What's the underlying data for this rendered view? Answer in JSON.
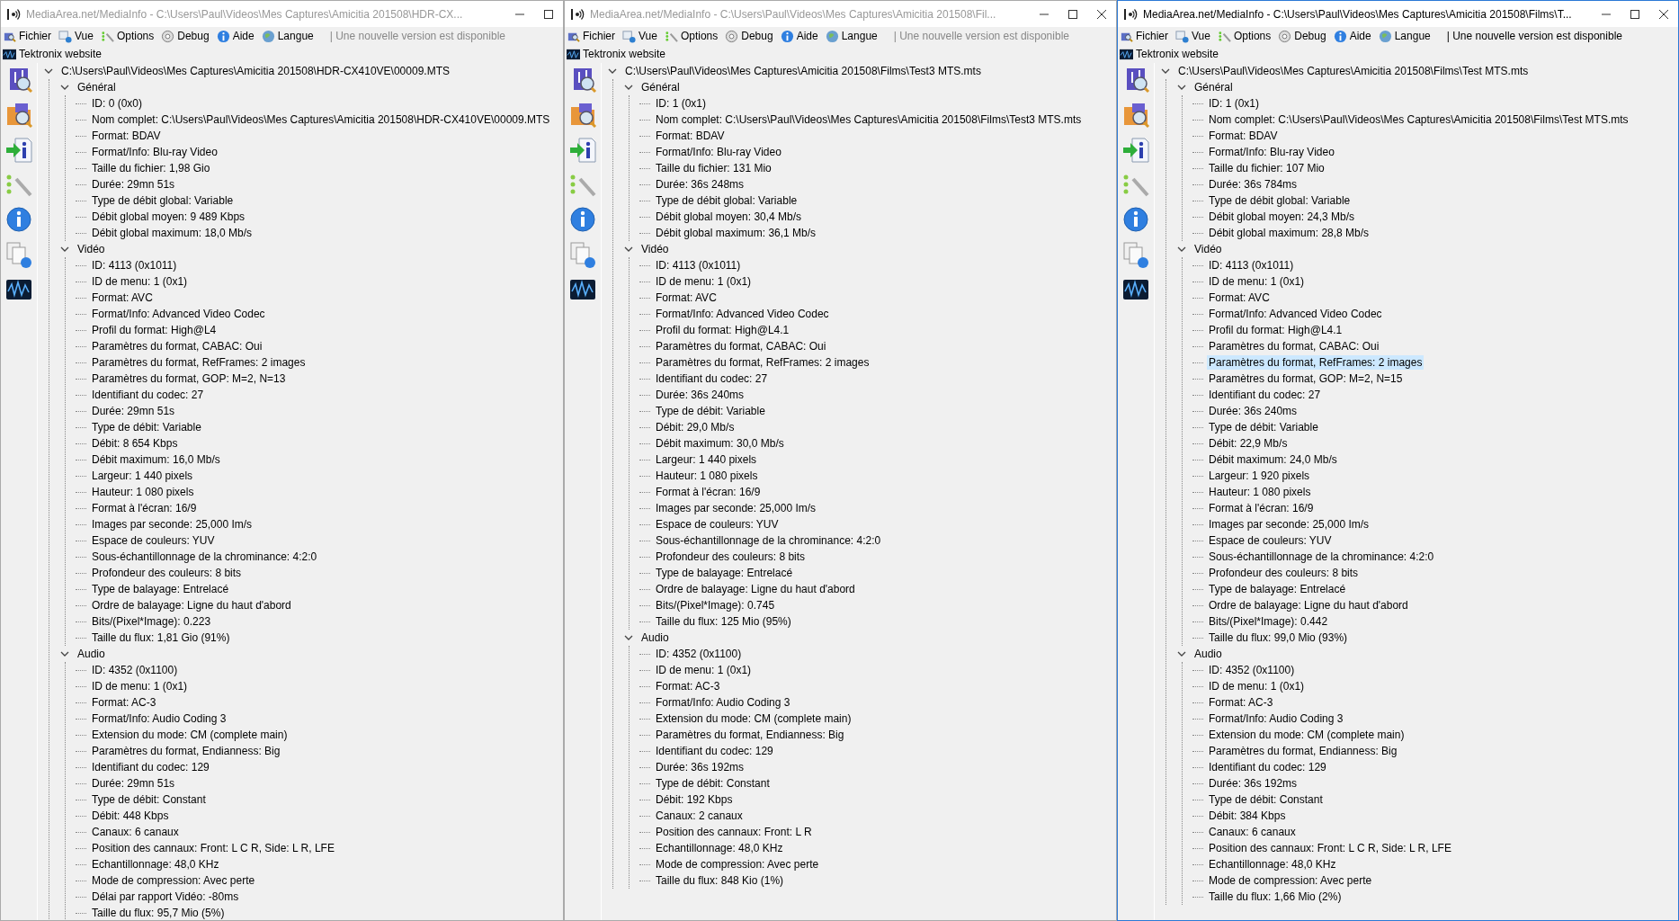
{
  "windows": [
    {
      "title": "MediaArea.net/MediaInfo - C:\\Users\\Paul\\Videos\\Mes Captures\\Amicitia 201508\\HDR-CX...",
      "active": false,
      "controls": [
        {
          "kind": "minimize"
        },
        {
          "kind": "maximize"
        }
      ],
      "menu": [
        "Fichier",
        "Vue",
        "Options",
        "Debug",
        "Aide",
        "Langue"
      ],
      "notice": "| Une nouvelle version est disponible",
      "website": "Tektronix website",
      "tree": {
        "text": "C:\\Users\\Paul\\Videos\\Mes Captures\\Amicitia 201508\\HDR-CX410VE\\00009.MTS",
        "expanded": true,
        "selected": false,
        "children": [
          {
            "text": "Général",
            "expanded": true,
            "selected": false,
            "children": [
              {
                "text": "ID: 0 (0x0)",
                "selected": false
              },
              {
                "text": "Nom complet: C:\\Users\\Paul\\Videos\\Mes Captures\\Amicitia 201508\\HDR-CX410VE\\00009.MTS",
                "selected": false
              },
              {
                "text": "Format: BDAV",
                "selected": false
              },
              {
                "text": "Format/Info: Blu-ray Video",
                "selected": false
              },
              {
                "text": "Taille du fichier: 1,98 Gio",
                "selected": false
              },
              {
                "text": "Durée: 29mn 51s",
                "selected": false
              },
              {
                "text": "Type de débit global: Variable",
                "selected": false
              },
              {
                "text": "Débit global moyen: 9 489 Kbps",
                "selected": false
              },
              {
                "text": "Débit global maximum: 18,0 Mb/s",
                "selected": false
              }
            ]
          },
          {
            "text": "Vidéo",
            "expanded": true,
            "selected": false,
            "children": [
              {
                "text": "ID: 4113 (0x1011)",
                "selected": false
              },
              {
                "text": "ID de menu: 1 (0x1)",
                "selected": false
              },
              {
                "text": "Format: AVC",
                "selected": false
              },
              {
                "text": "Format/Info: Advanced Video Codec",
                "selected": false
              },
              {
                "text": "Profil du format: High@L4",
                "selected": false
              },
              {
                "text": "Paramètres du format, CABAC: Oui",
                "selected": false
              },
              {
                "text": "Paramètres du format, RefFrames: 2 images",
                "selected": false
              },
              {
                "text": "Paramètres du format, GOP: M=2, N=13",
                "selected": false
              },
              {
                "text": "Identifiant du codec: 27",
                "selected": false
              },
              {
                "text": "Durée: 29mn 51s",
                "selected": false
              },
              {
                "text": "Type de débit: Variable",
                "selected": false
              },
              {
                "text": "Débit: 8 654 Kbps",
                "selected": false
              },
              {
                "text": "Débit maximum: 16,0 Mb/s",
                "selected": false
              },
              {
                "text": "Largeur: 1 440 pixels",
                "selected": false
              },
              {
                "text": "Hauteur: 1 080 pixels",
                "selected": false
              },
              {
                "text": "Format à l'écran: 16/9",
                "selected": false
              },
              {
                "text": "Images par seconde: 25,000 Im/s",
                "selected": false
              },
              {
                "text": "Espace de couleurs: YUV",
                "selected": false
              },
              {
                "text": "Sous-échantillonnage de la chrominance: 4:2:0",
                "selected": false
              },
              {
                "text": "Profondeur des couleurs: 8 bits",
                "selected": false
              },
              {
                "text": "Type de balayage: Entrelacé",
                "selected": false
              },
              {
                "text": "Ordre de balayage: Ligne du haut d'abord",
                "selected": false
              },
              {
                "text": "Bits/(Pixel*Image): 0.223",
                "selected": false
              },
              {
                "text": "Taille du flux: 1,81 Gio (91%)",
                "selected": false
              }
            ]
          },
          {
            "text": "Audio",
            "expanded": true,
            "selected": false,
            "children": [
              {
                "text": "ID: 4352 (0x1100)",
                "selected": false
              },
              {
                "text": "ID de menu: 1 (0x1)",
                "selected": false
              },
              {
                "text": "Format: AC-3",
                "selected": false
              },
              {
                "text": "Format/Info: Audio Coding 3",
                "selected": false
              },
              {
                "text": "Extension du mode: CM (complete main)",
                "selected": false
              },
              {
                "text": "Paramètres du format, Endianness: Big",
                "selected": false
              },
              {
                "text": "Identifiant du codec: 129",
                "selected": false
              },
              {
                "text": "Durée: 29mn 51s",
                "selected": false
              },
              {
                "text": "Type de débit: Constant",
                "selected": false
              },
              {
                "text": "Débit: 448 Kbps",
                "selected": false
              },
              {
                "text": "Canaux: 6 canaux",
                "selected": false
              },
              {
                "text": "Position des cannaux: Front: L C R, Side: L R, LFE",
                "selected": false
              },
              {
                "text": "Echantillonnage: 48,0 KHz",
                "selected": false
              },
              {
                "text": "Mode de compression: Avec perte",
                "selected": false
              },
              {
                "text": "Délai par rapport Vidéo: -80ms",
                "selected": false
              },
              {
                "text": "Taille du flux: 95,7 Mio (5%)",
                "selected": false
              }
            ]
          }
        ]
      }
    },
    {
      "title": "MediaArea.net/MediaInfo - C:\\Users\\Paul\\Videos\\Mes Captures\\Amicitia 201508\\Fil...",
      "active": false,
      "controls": [
        {
          "kind": "minimize"
        },
        {
          "kind": "maximize"
        },
        {
          "kind": "close"
        }
      ],
      "menu": [
        "Fichier",
        "Vue",
        "Options",
        "Debug",
        "Aide",
        "Langue"
      ],
      "notice": "| Une nouvelle version est disponible",
      "website": "Tektronix website",
      "tree": {
        "text": "C:\\Users\\Paul\\Videos\\Mes Captures\\Amicitia 201508\\Films\\Test3 MTS.mts",
        "expanded": true,
        "selected": false,
        "children": [
          {
            "text": "Général",
            "expanded": true,
            "selected": false,
            "children": [
              {
                "text": "ID: 1 (0x1)",
                "selected": false
              },
              {
                "text": "Nom complet: C:\\Users\\Paul\\Videos\\Mes Captures\\Amicitia 201508\\Films\\Test3 MTS.mts",
                "selected": false
              },
              {
                "text": "Format: BDAV",
                "selected": false
              },
              {
                "text": "Format/Info: Blu-ray Video",
                "selected": false
              },
              {
                "text": "Taille du fichier: 131 Mio",
                "selected": false
              },
              {
                "text": "Durée: 36s 248ms",
                "selected": false
              },
              {
                "text": "Type de débit global: Variable",
                "selected": false
              },
              {
                "text": "Débit global moyen: 30,4 Mb/s",
                "selected": false
              },
              {
                "text": "Débit global maximum: 36,1 Mb/s",
                "selected": false
              }
            ]
          },
          {
            "text": "Vidéo",
            "expanded": true,
            "selected": false,
            "children": [
              {
                "text": "ID: 4113 (0x1011)",
                "selected": false
              },
              {
                "text": "ID de menu: 1 (0x1)",
                "selected": false
              },
              {
                "text": "Format: AVC",
                "selected": false
              },
              {
                "text": "Format/Info: Advanced Video Codec",
                "selected": false
              },
              {
                "text": "Profil du format: High@L4.1",
                "selected": false
              },
              {
                "text": "Paramètres du format, CABAC: Oui",
                "selected": false
              },
              {
                "text": "Paramètres du format, RefFrames: 2 images",
                "selected": false
              },
              {
                "text": "Identifiant du codec: 27",
                "selected": false
              },
              {
                "text": "Durée: 36s 240ms",
                "selected": false
              },
              {
                "text": "Type de débit: Variable",
                "selected": false
              },
              {
                "text": "Débit: 29,0 Mb/s",
                "selected": false
              },
              {
                "text": "Débit maximum: 30,0 Mb/s",
                "selected": false
              },
              {
                "text": "Largeur: 1 440 pixels",
                "selected": false
              },
              {
                "text": "Hauteur: 1 080 pixels",
                "selected": false
              },
              {
                "text": "Format à l'écran: 16/9",
                "selected": false
              },
              {
                "text": "Images par seconde: 25,000 Im/s",
                "selected": false
              },
              {
                "text": "Espace de couleurs: YUV",
                "selected": false
              },
              {
                "text": "Sous-échantillonnage de la chrominance: 4:2:0",
                "selected": false
              },
              {
                "text": "Profondeur des couleurs: 8 bits",
                "selected": false
              },
              {
                "text": "Type de balayage: Entrelacé",
                "selected": false
              },
              {
                "text": "Ordre de balayage: Ligne du haut d'abord",
                "selected": false
              },
              {
                "text": "Bits/(Pixel*Image): 0.745",
                "selected": false
              },
              {
                "text": "Taille du flux: 125 Mio (95%)",
                "selected": false
              }
            ]
          },
          {
            "text": "Audio",
            "expanded": true,
            "selected": false,
            "children": [
              {
                "text": "ID: 4352 (0x1100)",
                "selected": false
              },
              {
                "text": "ID de menu: 1 (0x1)",
                "selected": false
              },
              {
                "text": "Format: AC-3",
                "selected": false
              },
              {
                "text": "Format/Info: Audio Coding 3",
                "selected": false
              },
              {
                "text": "Extension du mode: CM (complete main)",
                "selected": false
              },
              {
                "text": "Paramètres du format, Endianness: Big",
                "selected": false
              },
              {
                "text": "Identifiant du codec: 129",
                "selected": false
              },
              {
                "text": "Durée: 36s 192ms",
                "selected": false
              },
              {
                "text": "Type de débit: Constant",
                "selected": false
              },
              {
                "text": "Débit: 192 Kbps",
                "selected": false
              },
              {
                "text": "Canaux: 2 canaux",
                "selected": false
              },
              {
                "text": "Position des cannaux: Front: L R",
                "selected": false
              },
              {
                "text": "Echantillonnage: 48,0 KHz",
                "selected": false
              },
              {
                "text": "Mode de compression: Avec perte",
                "selected": false
              },
              {
                "text": "Taille du flux: 848 Kio (1%)",
                "selected": false
              }
            ]
          }
        ]
      }
    },
    {
      "title": "MediaArea.net/MediaInfo - C:\\Users\\Paul\\Videos\\Mes Captures\\Amicitia 201508\\Films\\T...",
      "active": true,
      "controls": [
        {
          "kind": "minimize"
        },
        {
          "kind": "maximize"
        },
        {
          "kind": "close"
        }
      ],
      "menu": [
        "Fichier",
        "Vue",
        "Options",
        "Debug",
        "Aide",
        "Langue"
      ],
      "notice": "| Une nouvelle version est disponible",
      "website": "Tektronix website",
      "tree": {
        "text": "C:\\Users\\Paul\\Videos\\Mes Captures\\Amicitia 201508\\Films\\Test MTS.mts",
        "expanded": true,
        "selected": false,
        "children": [
          {
            "text": "Général",
            "expanded": true,
            "selected": false,
            "children": [
              {
                "text": "ID: 1 (0x1)",
                "selected": false
              },
              {
                "text": "Nom complet: C:\\Users\\Paul\\Videos\\Mes Captures\\Amicitia 201508\\Films\\Test MTS.mts",
                "selected": false
              },
              {
                "text": "Format: BDAV",
                "selected": false
              },
              {
                "text": "Format/Info: Blu-ray Video",
                "selected": false
              },
              {
                "text": "Taille du fichier: 107 Mio",
                "selected": false
              },
              {
                "text": "Durée: 36s 784ms",
                "selected": false
              },
              {
                "text": "Type de débit global: Variable",
                "selected": false
              },
              {
                "text": "Débit global moyen: 24,3 Mb/s",
                "selected": false
              },
              {
                "text": "Débit global maximum: 28,8 Mb/s",
                "selected": false
              }
            ]
          },
          {
            "text": "Vidéo",
            "expanded": true,
            "selected": false,
            "children": [
              {
                "text": "ID: 4113 (0x1011)",
                "selected": false
              },
              {
                "text": "ID de menu: 1 (0x1)",
                "selected": false
              },
              {
                "text": "Format: AVC",
                "selected": false
              },
              {
                "text": "Format/Info: Advanced Video Codec",
                "selected": false
              },
              {
                "text": "Profil du format: High@L4.1",
                "selected": false
              },
              {
                "text": "Paramètres du format, CABAC: Oui",
                "selected": false
              },
              {
                "text": "Paramètres du format, RefFrames: 2 images",
                "selected": true
              },
              {
                "text": "Paramètres du format, GOP: M=2, N=15",
                "selected": false
              },
              {
                "text": "Identifiant du codec: 27",
                "selected": false
              },
              {
                "text": "Durée: 36s 240ms",
                "selected": false
              },
              {
                "text": "Type de débit: Variable",
                "selected": false
              },
              {
                "text": "Débit: 22,9 Mb/s",
                "selected": false
              },
              {
                "text": "Débit maximum: 24,0 Mb/s",
                "selected": false
              },
              {
                "text": "Largeur: 1 920 pixels",
                "selected": false
              },
              {
                "text": "Hauteur: 1 080 pixels",
                "selected": false
              },
              {
                "text": "Format à l'écran: 16/9",
                "selected": false
              },
              {
                "text": "Images par seconde: 25,000 Im/s",
                "selected": false
              },
              {
                "text": "Espace de couleurs: YUV",
                "selected": false
              },
              {
                "text": "Sous-échantillonnage de la chrominance: 4:2:0",
                "selected": false
              },
              {
                "text": "Profondeur des couleurs: 8 bits",
                "selected": false
              },
              {
                "text": "Type de balayage: Entrelacé",
                "selected": false
              },
              {
                "text": "Ordre de balayage: Ligne du haut d'abord",
                "selected": false
              },
              {
                "text": "Bits/(Pixel*Image): 0.442",
                "selected": false
              },
              {
                "text": "Taille du flux: 99,0 Mio (93%)",
                "selected": false
              }
            ]
          },
          {
            "text": "Audio",
            "expanded": true,
            "selected": false,
            "children": [
              {
                "text": "ID: 4352 (0x1100)",
                "selected": false
              },
              {
                "text": "ID de menu: 1 (0x1)",
                "selected": false
              },
              {
                "text": "Format: AC-3",
                "selected": false
              },
              {
                "text": "Format/Info: Audio Coding 3",
                "selected": false
              },
              {
                "text": "Extension du mode: CM (complete main)",
                "selected": false
              },
              {
                "text": "Paramètres du format, Endianness: Big",
                "selected": false
              },
              {
                "text": "Identifiant du codec: 129",
                "selected": false
              },
              {
                "text": "Durée: 36s 192ms",
                "selected": false
              },
              {
                "text": "Type de débit: Constant",
                "selected": false
              },
              {
                "text": "Débit: 384 Kbps",
                "selected": false
              },
              {
                "text": "Canaux: 6 canaux",
                "selected": false
              },
              {
                "text": "Position des cannaux: Front: L C R, Side: L R, LFE",
                "selected": false
              },
              {
                "text": "Echantillonnage: 48,0 KHz",
                "selected": false
              },
              {
                "text": "Mode de compression: Avec perte",
                "selected": false
              },
              {
                "text": "Taille du flux: 1,66 Mio (2%)",
                "selected": false
              }
            ]
          }
        ]
      }
    }
  ]
}
